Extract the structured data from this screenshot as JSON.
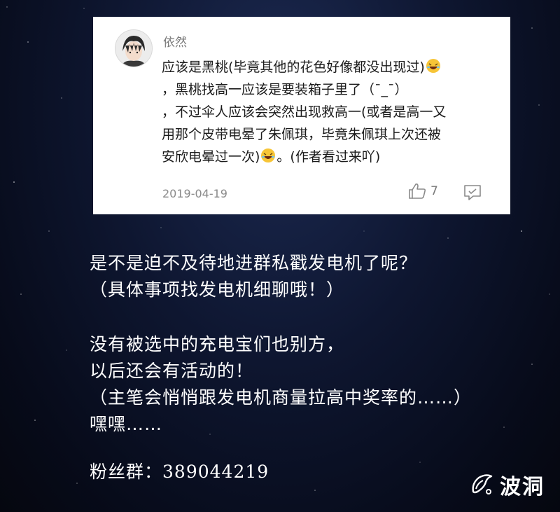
{
  "comment": {
    "username": "依然",
    "lines": [
      "应该是黑桃(毕竟其他的花色好像都没出现过)",
      "，黑桃找高一应该是要装箱子里了（¯_¯）",
      "，不过伞人应该会突然出现救高一(或者是高一又",
      "用那个皮带电晕了朱佩琪，毕竟朱佩琪上次还被",
      "安欣电晕过一次)",
      "。(作者看过来吖)"
    ],
    "date": "2019-04-19",
    "like_count": "7"
  },
  "message": {
    "line1": "是不是迫不及待地进群私戳发电机了呢？",
    "line2": "（具体事项找发电机细聊哦！）",
    "line3": "没有被选中的充电宝们也别方，",
    "line4": "以后还会有活动的！",
    "line5": "（主笔会悄悄跟发电机商量拉高中奖率的……）",
    "line6": "嘿嘿……"
  },
  "fans_group": {
    "label": "粉丝群：",
    "number": "389044219"
  },
  "watermark": {
    "text": "波洞"
  },
  "icons": {
    "emoji": "laughing-emoji",
    "like": "thumbs-up-icon",
    "reply": "comment-bubble-icon"
  }
}
